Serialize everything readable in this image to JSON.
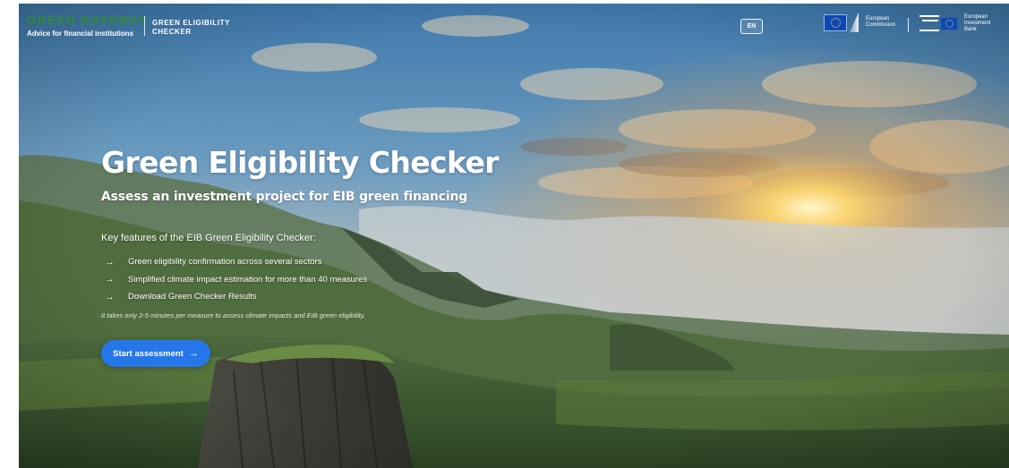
{
  "header": {
    "brand_name": "GREEN GATEWAY",
    "brand_subtitle": "Advice for financial institutions",
    "product_name": "GREEN ELIGIBILITY CHECKER",
    "language": "EN",
    "logos": [
      {
        "name": "European Commission",
        "text": "European Commission",
        "icon": "eu-flag-icon"
      },
      {
        "name": "European Investment Bank",
        "text": "European Investment Bank",
        "icon": "eib-logo-icon"
      }
    ]
  },
  "hero": {
    "title": "Green Eligibility Checker",
    "subtitle": "Assess an investment project for EIB green financing"
  },
  "features": {
    "heading": "Key features of the EIB Green Eligibility Checker:",
    "items": [
      {
        "icon": "arrow-right-icon",
        "label": "Green eligibility confirmation across several sectors"
      },
      {
        "icon": "arrow-right-icon",
        "label": "Simplified climate impact estimation for more than 40 measures"
      },
      {
        "icon": "arrow-right-icon",
        "label": "Download Green Checker Results"
      }
    ]
  },
  "note": "It takes only 2-5 minutes per measure to assess climate impacts and EIB green eligibility.",
  "cta": {
    "label": "Start assessment",
    "icon": "arrow-right-icon",
    "color": "#2577e9"
  },
  "colors": {
    "brand_green": "#2f8a3c",
    "accent_blue": "#2577e9",
    "text_light": "#ffffff"
  }
}
